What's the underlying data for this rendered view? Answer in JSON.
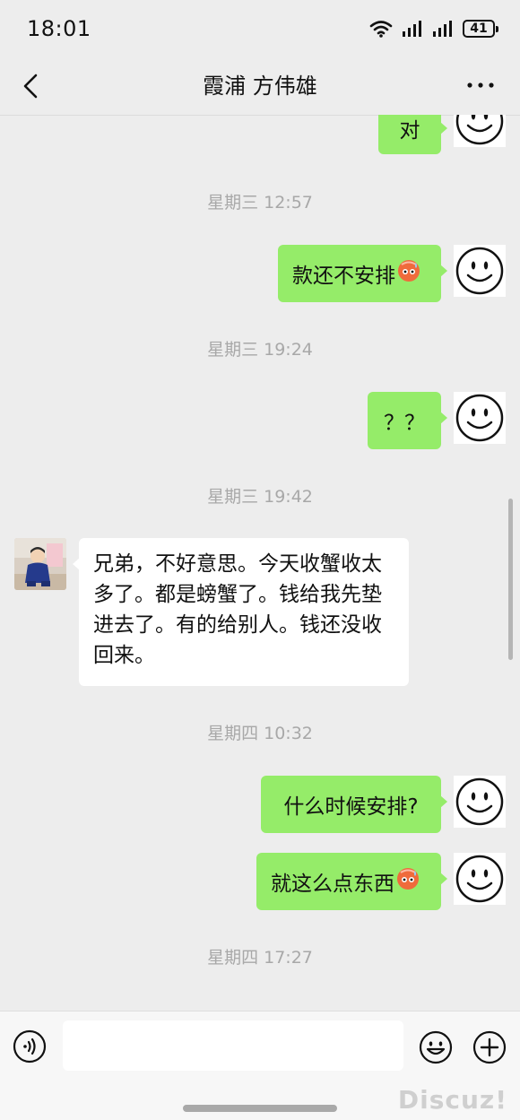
{
  "status_bar": {
    "time": "18:01",
    "battery": "41"
  },
  "header": {
    "title": "霞浦 方伟雄"
  },
  "messages": [
    {
      "type": "sent",
      "text": "对"
    },
    {
      "type": "time",
      "text": "星期三 12:57"
    },
    {
      "type": "sent",
      "text": "款还不安排",
      "emoji": "sweat-emoji"
    },
    {
      "type": "time",
      "text": "星期三 19:24"
    },
    {
      "type": "sent",
      "text": "？？"
    },
    {
      "type": "time",
      "text": "星期三 19:42"
    },
    {
      "type": "received",
      "lines": [
        "兄弟，不好意思。今天收蟹收太",
        "多了。都是螃蟹了。钱给我先垫",
        "进去了。有的给别人。钱还没收",
        "回来。"
      ]
    },
    {
      "type": "time",
      "text": "星期四 10:32"
    },
    {
      "type": "sent",
      "text": "什么时候安排?"
    },
    {
      "type": "sent",
      "text": "就这么点东西",
      "emoji": "sweat-emoji"
    },
    {
      "type": "time",
      "text": "星期四 17:27"
    }
  ],
  "input": {
    "placeholder": ""
  },
  "watermark": "Discuz!",
  "colors": {
    "sent_bubble": "#95ec69",
    "received_bubble": "#ffffff",
    "background": "#ededed"
  }
}
